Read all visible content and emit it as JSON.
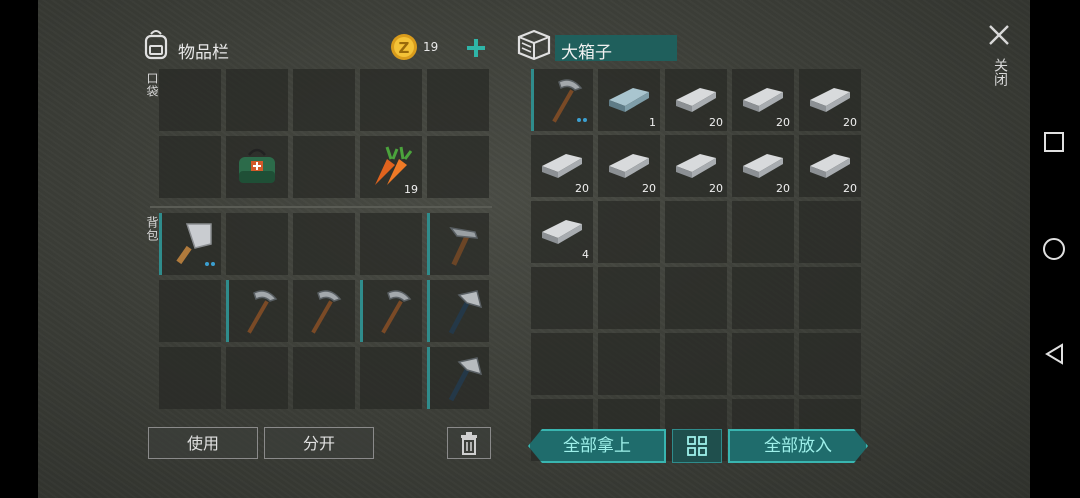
{
  "inventory": {
    "title": "物品栏",
    "coins": "19",
    "pocket_label": "口袋",
    "backpack_label": "背包",
    "pocket_slots": [
      {
        "icon": "",
        "qty": ""
      },
      {
        "icon": "",
        "qty": ""
      },
      {
        "icon": "",
        "qty": ""
      },
      {
        "icon": "",
        "qty": ""
      },
      {
        "icon": "",
        "qty": ""
      },
      {
        "icon": "",
        "qty": ""
      },
      {
        "icon": "bag-icon",
        "qty": ""
      },
      {
        "icon": "",
        "qty": ""
      },
      {
        "icon": "carrot-icon",
        "qty": "19"
      },
      {
        "icon": "",
        "qty": ""
      }
    ],
    "backpack_slots": [
      {
        "icon": "cleaver-icon",
        "qty": ""
      },
      {
        "icon": "",
        "qty": ""
      },
      {
        "icon": "",
        "qty": ""
      },
      {
        "icon": "",
        "qty": ""
      },
      {
        "icon": "hammer-icon",
        "qty": ""
      },
      {
        "icon": "",
        "qty": ""
      },
      {
        "icon": "pickaxe-icon",
        "qty": ""
      },
      {
        "icon": "pickaxe-icon",
        "qty": ""
      },
      {
        "icon": "pickaxe-icon",
        "qty": ""
      },
      {
        "icon": "axe-icon",
        "qty": ""
      },
      {
        "icon": "",
        "qty": ""
      },
      {
        "icon": "",
        "qty": ""
      },
      {
        "icon": "",
        "qty": ""
      },
      {
        "icon": "",
        "qty": ""
      },
      {
        "icon": "axe-icon",
        "qty": ""
      }
    ],
    "use_label": "使用",
    "split_label": "分开"
  },
  "container": {
    "title": "大箱子",
    "slots": [
      {
        "icon": "pickaxe-icon",
        "qty": ""
      },
      {
        "icon": "steel-bar-icon",
        "qty": "1"
      },
      {
        "icon": "iron-bar-icon",
        "qty": "20"
      },
      {
        "icon": "iron-bar-icon",
        "qty": "20"
      },
      {
        "icon": "iron-bar-icon",
        "qty": "20"
      },
      {
        "icon": "iron-bar-icon",
        "qty": "20"
      },
      {
        "icon": "iron-bar-icon",
        "qty": "20"
      },
      {
        "icon": "iron-bar-icon",
        "qty": "20"
      },
      {
        "icon": "iron-bar-icon",
        "qty": "20"
      },
      {
        "icon": "iron-bar-icon",
        "qty": "20"
      },
      {
        "icon": "iron-bar-icon",
        "qty": "4"
      }
    ],
    "take_all_label": "全部拿上",
    "put_all_label": "全部放入"
  },
  "close_label": "关闭"
}
